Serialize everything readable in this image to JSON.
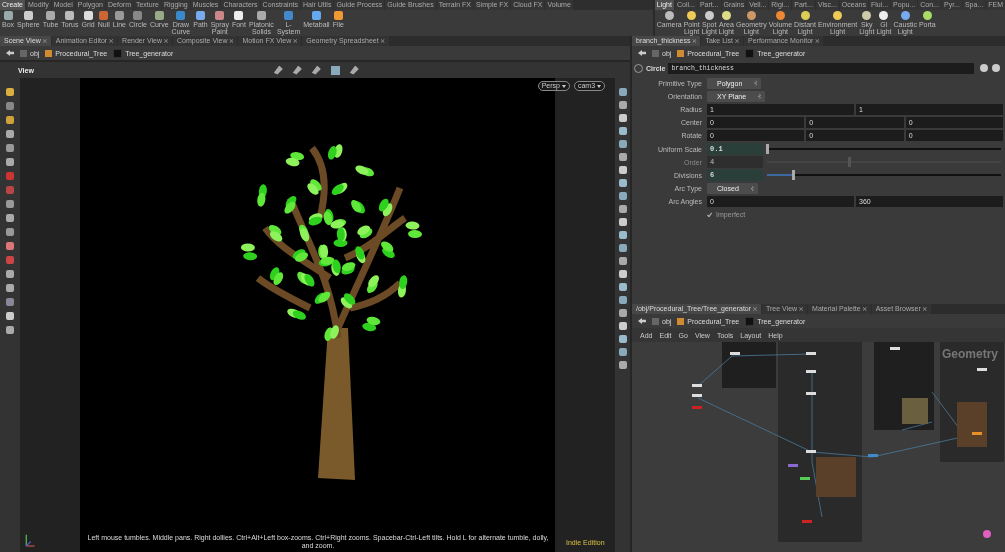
{
  "shelf_left": {
    "tabs": [
      {
        "label": "Create",
        "selected": true
      },
      {
        "label": "Modify",
        "selected": false
      },
      {
        "label": "Model",
        "selected": false
      },
      {
        "label": "Polygon",
        "selected": false
      },
      {
        "label": "Deform",
        "selected": false
      },
      {
        "label": "Texture",
        "selected": false
      },
      {
        "label": "Rigging",
        "selected": false
      },
      {
        "label": "Muscles",
        "selected": false
      },
      {
        "label": "Characters",
        "selected": false
      },
      {
        "label": "Constraints",
        "selected": false
      },
      {
        "label": "Hair Utils",
        "selected": false
      },
      {
        "label": "Guide Process",
        "selected": false
      },
      {
        "label": "Guide Brushes",
        "selected": false
      },
      {
        "label": "Terrain FX",
        "selected": false
      },
      {
        "label": "Simple FX",
        "selected": false
      },
      {
        "label": "Cloud FX",
        "selected": false
      },
      {
        "label": "Volume",
        "selected": false
      }
    ],
    "tools": [
      "Box",
      "Sphere",
      "Tube",
      "Torus",
      "Grid",
      "Null",
      "Line",
      "Circle",
      "Curve",
      "Draw Curve",
      "Path",
      "Spray Paint",
      "Font",
      "Platonic Solids",
      "L-System",
      "Metaball",
      "File"
    ]
  },
  "shelf_right": {
    "tabs": [
      {
        "label": "Light",
        "selected": true
      },
      {
        "label": "Coll...",
        "selected": false
      },
      {
        "label": "Part...",
        "selected": false
      },
      {
        "label": "Grains",
        "selected": false
      },
      {
        "label": "Vell...",
        "selected": false
      },
      {
        "label": "Rigi...",
        "selected": false
      },
      {
        "label": "Part...",
        "selected": false
      },
      {
        "label": "Visc...",
        "selected": false
      },
      {
        "label": "Oceans",
        "selected": false
      },
      {
        "label": "Flui...",
        "selected": false
      },
      {
        "label": "Popu...",
        "selected": false
      },
      {
        "label": "Con...",
        "selected": false
      },
      {
        "label": "Pyr...",
        "selected": false
      },
      {
        "label": "Spa...",
        "selected": false
      },
      {
        "label": "FEM",
        "selected": false
      }
    ],
    "tools": [
      "Camera",
      "Point Light",
      "Spot Light",
      "Area Light",
      "Geometry Light",
      "Volume Light",
      "Distant Light",
      "Environment Light",
      "Sky Light",
      "GI Light",
      "Caustic Light",
      "Porta"
    ]
  },
  "scene_pane": {
    "tabs": [
      {
        "label": "Scene View",
        "selected": true
      },
      {
        "label": "Animation Editor",
        "selected": false
      },
      {
        "label": "Render View",
        "selected": false
      },
      {
        "label": "Composite View",
        "selected": false
      },
      {
        "label": "Motion FX View",
        "selected": false
      },
      {
        "label": "Geometry Spreadsheet",
        "selected": false
      }
    ],
    "path": [
      "obj",
      "Procedural_Tree",
      "Tree_generator"
    ],
    "title": "View",
    "projection": "Persp",
    "camera": "cam3",
    "hint": "Left mouse tumbles. Middle pans. Right dollies. Ctrl+Alt+Left box-zooms. Ctrl+Right zooms. Spacebar-Ctrl-Left tilts. Hold L for alternate tumble, dolly, and zoom.",
    "edition": "Indie Edition"
  },
  "params_pane": {
    "tabs": [
      {
        "label": "branch_thickness",
        "selected": true
      },
      {
        "label": "Take List",
        "selected": false
      },
      {
        "label": "Performance Monitor",
        "selected": false
      }
    ],
    "path": [
      "obj",
      "Procedural_Tree",
      "Tree_generator"
    ],
    "node_type": "Circle",
    "node_name": "branch_thickness",
    "params": [
      {
        "kind": "menu",
        "label": "Primitive Type",
        "value": "Polygon"
      },
      {
        "kind": "menu",
        "label": "Orientation",
        "value": "XY Plane"
      },
      {
        "kind": "vector",
        "label": "Radius",
        "values": [
          "1",
          "1"
        ]
      },
      {
        "kind": "vector",
        "label": "Center",
        "values": [
          "0",
          "0",
          "0"
        ]
      },
      {
        "kind": "vector",
        "label": "Rotate",
        "values": [
          "0",
          "0",
          "0"
        ]
      },
      {
        "kind": "slider",
        "label": "Uniform Scale",
        "value": "0.1",
        "level": 0.0,
        "disabled": false
      },
      {
        "kind": "slider",
        "label": "Order",
        "value": "4",
        "level": 0.35,
        "disabled": true
      },
      {
        "kind": "slider",
        "label": "Divisions",
        "value": "6",
        "level": 0.11,
        "disabled": false
      },
      {
        "kind": "menu",
        "label": "Arc Type",
        "value": "Closed"
      },
      {
        "kind": "vector",
        "label": "Arc Angles",
        "values": [
          "0",
          "360"
        ]
      },
      {
        "kind": "toggle",
        "label": "Imperfect",
        "checked": true,
        "disabled": true
      }
    ]
  },
  "network_pane": {
    "tabs": [
      {
        "label": "/obj/Procedural_Tree/Tree_generator",
        "selected": true
      },
      {
        "label": "Tree View",
        "selected": false
      },
      {
        "label": "Material Palette",
        "selected": false
      },
      {
        "label": "Asset Browser",
        "selected": false
      }
    ],
    "path": [
      "obj",
      "Procedural_Tree",
      "Tree_generator"
    ],
    "menu": [
      "Add",
      "Edit",
      "Go",
      "View",
      "Tools",
      "Layout",
      "Help"
    ],
    "box_label": "Geometry"
  }
}
